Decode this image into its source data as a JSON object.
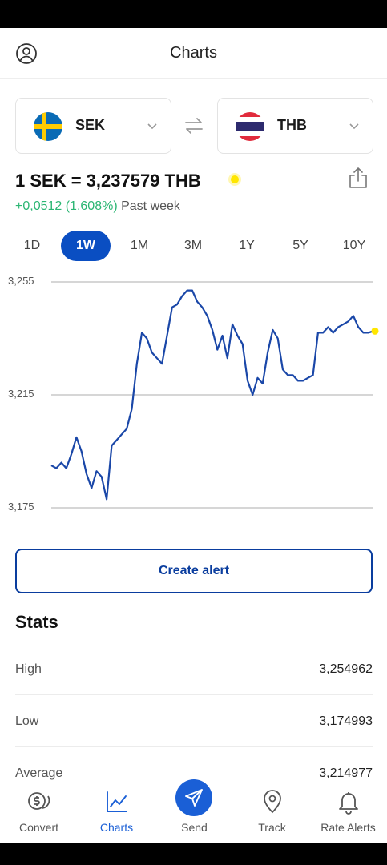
{
  "header": {
    "title": "Charts",
    "profile_icon": "profile-icon"
  },
  "from_currency": {
    "code": "SEK",
    "flag": "sweden-flag-icon"
  },
  "to_currency": {
    "code": "THB",
    "flag": "thailand-flag-icon"
  },
  "rate": {
    "text": "1 SEK = 3,237579 THB",
    "change": "+0,0512 (1,608%)",
    "change_label": "Past week",
    "live_indicator_color": "#ffe600"
  },
  "periods": [
    {
      "label": "1D",
      "active": false
    },
    {
      "label": "1W",
      "active": true
    },
    {
      "label": "1M",
      "active": false
    },
    {
      "label": "3M",
      "active": false
    },
    {
      "label": "1Y",
      "active": false
    },
    {
      "label": "5Y",
      "active": false
    },
    {
      "label": "10Y",
      "active": false
    }
  ],
  "chart_data": {
    "type": "line",
    "title": "",
    "xlabel": "",
    "ylabel": "",
    "ylim": [
      3.175,
      3.255
    ],
    "y_ticks": [
      "3,255",
      "3,215",
      "3,175"
    ],
    "grid": true,
    "color": "#1a47a8",
    "series": [
      {
        "values": [
          3.19,
          3.189,
          3.191,
          3.189,
          3.194,
          3.2,
          3.195,
          3.187,
          3.182,
          3.188,
          3.186,
          3.178,
          3.197,
          3.199,
          3.201,
          3.203,
          3.21,
          3.226,
          3.237,
          3.235,
          3.23,
          3.228,
          3.226,
          3.236,
          3.246,
          3.247,
          3.25,
          3.252,
          3.252,
          3.248,
          3.246,
          3.243,
          3.238,
          3.231,
          3.236,
          3.228,
          3.24,
          3.236,
          3.233,
          3.22,
          3.215,
          3.221,
          3.219,
          3.23,
          3.238,
          3.235,
          3.224,
          3.222,
          3.222,
          3.22,
          3.22,
          3.221,
          3.222,
          3.237,
          3.237,
          3.239,
          3.237,
          3.239,
          3.24,
          3.241,
          3.243,
          3.239,
          3.237,
          3.237,
          3.2376
        ]
      }
    ]
  },
  "alert_button": "Create alert",
  "stats": {
    "title": "Stats",
    "rows": [
      {
        "label": "High",
        "value": "3,254962"
      },
      {
        "label": "Low",
        "value": "3,174993"
      },
      {
        "label": "Average",
        "value": "3,214977"
      }
    ]
  },
  "nav": [
    {
      "label": "Convert",
      "icon": "convert-icon",
      "active": false
    },
    {
      "label": "Charts",
      "icon": "charts-icon",
      "active": true
    },
    {
      "label": "Send",
      "icon": "send-icon",
      "active": false
    },
    {
      "label": "Track",
      "icon": "location-pin-icon",
      "active": false
    },
    {
      "label": "Rate Alerts",
      "icon": "bell-icon",
      "active": false
    }
  ]
}
